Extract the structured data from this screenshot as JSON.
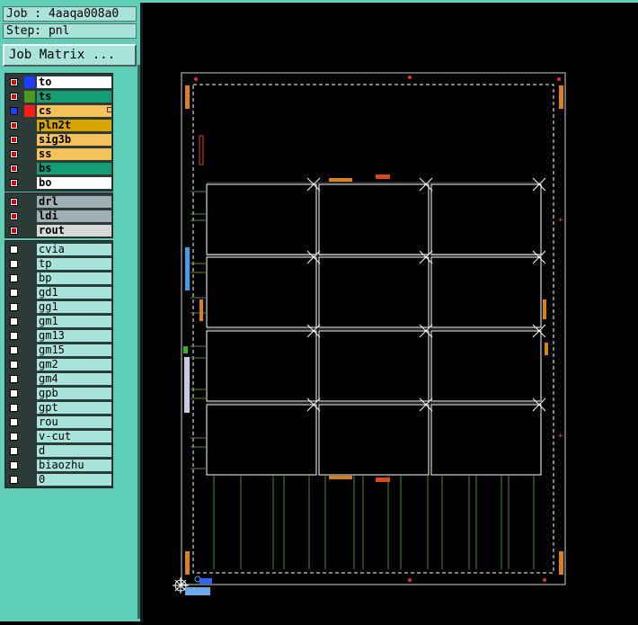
{
  "job": {
    "label": "Job : 4aaqa008a0"
  },
  "step": {
    "label": "Step: pnl"
  },
  "job_matrix_button": {
    "label": "Job Matrix ..."
  },
  "layer_groups": [
    {
      "name": "board-layers",
      "layers": [
        {
          "name": "to",
          "checked": true,
          "color": "#1e3cff",
          "bg": "#ffffff"
        },
        {
          "name": "ts",
          "checked": true,
          "color": "#4d9a1f",
          "bg": "#159d74"
        },
        {
          "name": "cs",
          "checked": false,
          "color": "#ff1a1a",
          "bg": "#f5c15a",
          "active": true,
          "marker": true
        },
        {
          "name": "pln2t",
          "checked": true,
          "color": "",
          "bg": "#d8a400"
        },
        {
          "name": "sig3b",
          "checked": true,
          "color": "",
          "bg": "#f5c15a"
        },
        {
          "name": "ss",
          "checked": true,
          "color": "",
          "bg": "#f5c15a"
        },
        {
          "name": "bs",
          "checked": true,
          "color": "",
          "bg": "#159d74"
        },
        {
          "name": "bo",
          "checked": true,
          "color": "",
          "bg": "#ffffff"
        }
      ]
    },
    {
      "name": "drill-layers",
      "layers": [
        {
          "name": "drl",
          "checked": true,
          "color": "",
          "bg": "#9fb0b5"
        },
        {
          "name": "ldi",
          "checked": true,
          "color": "",
          "bg": "#9fb0b5"
        },
        {
          "name": "rout",
          "checked": true,
          "color": "",
          "bg": "#d8d8d8"
        }
      ]
    },
    {
      "name": "misc-layers",
      "layers": [
        {
          "name": "cvia",
          "checked": false,
          "bg": "#a9e4dc"
        },
        {
          "name": "tp",
          "checked": false,
          "bg": "#a9e4dc"
        },
        {
          "name": "bp",
          "checked": false,
          "bg": "#a9e4dc"
        },
        {
          "name": "gd1",
          "checked": false,
          "bg": "#a9e4dc"
        },
        {
          "name": "gg1",
          "checked": false,
          "bg": "#a9e4dc"
        },
        {
          "name": "gm1",
          "checked": false,
          "bg": "#a9e4dc"
        },
        {
          "name": "gm13",
          "checked": false,
          "bg": "#a9e4dc"
        },
        {
          "name": "gm15",
          "checked": false,
          "bg": "#a9e4dc"
        },
        {
          "name": "gm2",
          "checked": false,
          "bg": "#a9e4dc"
        },
        {
          "name": "gm4",
          "checked": false,
          "bg": "#a9e4dc"
        },
        {
          "name": "gpb",
          "checked": false,
          "bg": "#a9e4dc"
        },
        {
          "name": "gpt",
          "checked": false,
          "bg": "#a9e4dc"
        },
        {
          "name": "rou",
          "checked": false,
          "bg": "#a9e4dc"
        },
        {
          "name": "v-cut",
          "checked": false,
          "bg": "#a9e4dc"
        },
        {
          "name": "d",
          "checked": false,
          "bg": "#a9e4dc"
        },
        {
          "name": "biaozhu",
          "checked": false,
          "bg": "#a9e4dc"
        },
        {
          "name": "0",
          "checked": false,
          "bg": "#a9e4dc"
        }
      ]
    }
  ],
  "panel": {
    "columns": 3,
    "rows": 4,
    "outline_color": "#ffffff",
    "trace_color": "#4c8c2a",
    "mark_color": "#e05a10"
  }
}
